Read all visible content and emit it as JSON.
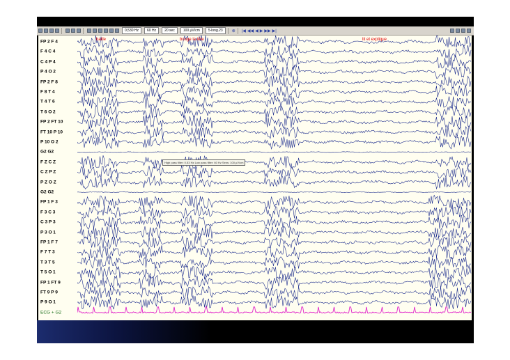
{
  "toolbar": {
    "selects": [
      "0,530 Hz",
      "60 Hz",
      "20 sec",
      "100 µV/cm",
      "5-long.23"
    ],
    "left_icons": [
      "open-icon",
      "save-icon",
      "print-icon",
      "preview-icon",
      "cut-icon",
      "copy-icon",
      "paste-icon",
      "montage-icon",
      "filter-icon",
      "zoom-icon",
      "settings-icon",
      "marker-icon",
      "grid-icon"
    ],
    "nav_icons": [
      "first-page-icon",
      "prev-fast-icon",
      "prev-icon",
      "play-back-icon",
      "play-icon",
      "next-icon",
      "next-fast-icon",
      "last-page-icon"
    ],
    "right_icons": [
      "pen-icon",
      "tools-icon",
      "camera-icon",
      "record-icon"
    ]
  },
  "annotations": [
    "baille",
    "bouge la tête",
    "lit et explique"
  ],
  "filter_info": "High pass filter: 0.53 Hz   Low pass filter: 60 Hz   Sens: 100 µV/cm",
  "channels": [
    "FP 2 F 4",
    "F 4 C 4",
    "C 4 P 4",
    "P 4 O 2",
    "FP 2 F 8",
    "F 8 T 4",
    "T 4 T 6",
    "T 6 O 2",
    "FP 2 FT 10",
    "FT 10 P 10",
    "P 10 O 2",
    "G2 G2",
    "F Z C Z",
    "C Z P Z",
    "P Z O Z",
    "G2 G2",
    "FP 1 F 3",
    "F 3 C 3",
    "C 3 P 3",
    "P 3 O 1",
    "FP 1 F 7",
    "F 7 T 3",
    "T 3 T 5",
    "T 5 O 1",
    "FP 1 FT 9",
    "FT 9 P 9",
    "P 9 O 1",
    "ECG + G2"
  ],
  "colors": {
    "trace": "#1a2a8c",
    "ecg": "#e020c8",
    "background": "#fffef0",
    "annotation": "#e00000",
    "label": "#000000"
  }
}
